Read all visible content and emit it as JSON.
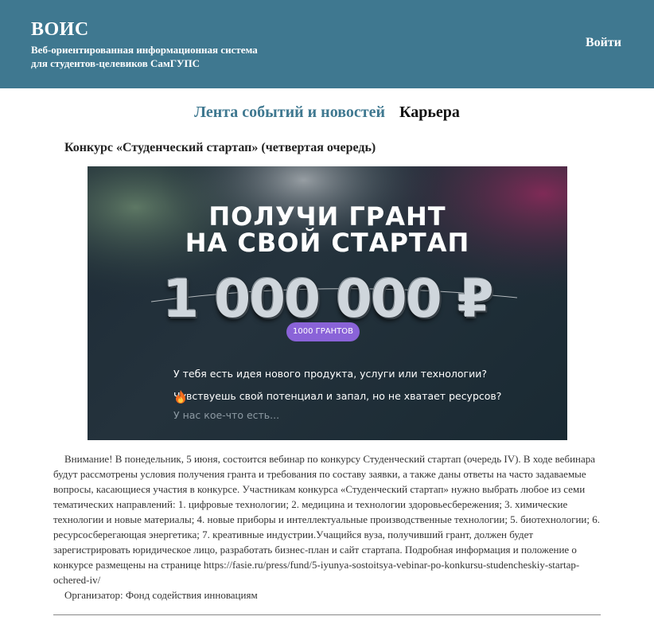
{
  "header": {
    "title": "ВОИС",
    "subtitle_line1": "Веб-ориентированная информационная система",
    "subtitle_line2": "для студентов-целевиков СамГУПС",
    "login_label": "Войти"
  },
  "tabs": [
    {
      "label": "Лента событий и новостей",
      "active": true
    },
    {
      "label": "Карьера",
      "active": false
    }
  ],
  "post": {
    "title": "Конкурс «Студенческий стартап» (четвертая очередь)",
    "banner": {
      "headline_line1": "ПОЛУЧИ ГРАНТ",
      "headline_line2": "НА СВОЙ СТАРТАП",
      "amount": "1 000 000 ₽",
      "badge": "1000 ГРАНТОВ",
      "question1": "У тебя есть идея нового продукта, услуги или технологии?",
      "question2_part1": "Чувствуешь свой потенциал и",
      "question2_part2": "запал, но не хватает ресурсов?",
      "question3": "У нас кое-что есть...",
      "fire_icon": "fire-icon"
    },
    "body": "Внимание! В понедельник, 5 июня, состоится вебинар по конкурсу Студенческий стартап (очередь IV). В ходе вебинара будут рассмотрены условия получения гранта и требования по составу заявки, а также даны ответы на часто задаваемые вопросы, касающиеся участия в конкурсе. Участникам конкурса «Студенческий стартап» нужно выбрать любое из семи тематических направлений: 1. цифровые технологии; 2. медицина и технологии здоровьесбережения; 3. химические технологии и новые материалы; 4. новые приборы и интеллектуальные производственные технологии; 5. биотехнологии; 6. ресурсосберегающая энергетика; 7. креативные индустрии.Учащийся вуза, получивший грант, должен будет зарегистрировать юридическое лицо, разработать бизнес-план и сайт стартапа. Подробная информация и положение о конкурсе размещены на странице https://fasie.ru/press/fund/5-iyunya-sostoitsya-vebinar-po-konkursu-studencheskiy-startap-ochered-iv/",
    "organizer": "Организатор: Фонд содействия инновациям"
  },
  "colors": {
    "header_bg": "#3f7890",
    "active_tab": "#3f7890",
    "badge": "#8a63d8"
  }
}
